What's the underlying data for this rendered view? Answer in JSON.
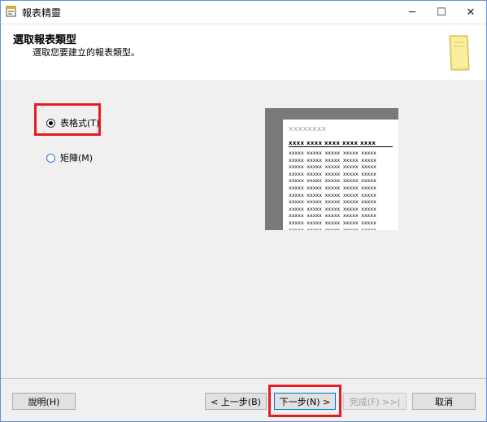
{
  "window": {
    "title": "報表精靈",
    "minimize_glyph": "─",
    "maximize_glyph": "☐",
    "close_glyph": "✕"
  },
  "header": {
    "title": "選取報表類型",
    "subtitle": "選取您要建立的報表類型。",
    "icon": "note-icon"
  },
  "options": {
    "tabular_label": "表格式(T)",
    "tabular_selected": true,
    "matrix_label": "矩陣(M)",
    "matrix_selected": false
  },
  "preview": {
    "title_text": "xxxxxxxx",
    "header_text": "xxxx  xxxx  xxxx  xxxx  xxxx",
    "rows_text": "xxxxx xxxxx xxxxx xxxxx xxxxx\nxxxxx xxxxx xxxxx xxxxx xxxxx\nxxxxx xxxxx xxxxx xxxxx xxxxx\nxxxxx xxxxx xxxxx xxxxx xxxxx\nxxxxx xxxxx xxxxx xxxxx xxxxx\nxxxxx xxxxx xxxxx xxxxx xxxxx\nxxxxx xxxxx xxxxx xxxxx xxxxx\nxxxxx xxxxx xxxxx xxxxx xxxxx\nxxxxx xxxxx xxxxx xxxxx xxxxx\nxxxxx xxxxx xxxxx xxxxx xxxxx\nxxxxx xxxxx xxxxx xxxxx xxxxx\nxxxxx xxxxx xxxxx xxxxx xxxxx"
  },
  "footer": {
    "help_label": "說明(H)",
    "back_label": "< 上一步(B)",
    "next_label": "下一步(N) >",
    "finish_label": "完成(F) >>|",
    "cancel_label": "取消"
  },
  "colors": {
    "highlight": "#e51c23",
    "accent": "#0078d7"
  }
}
